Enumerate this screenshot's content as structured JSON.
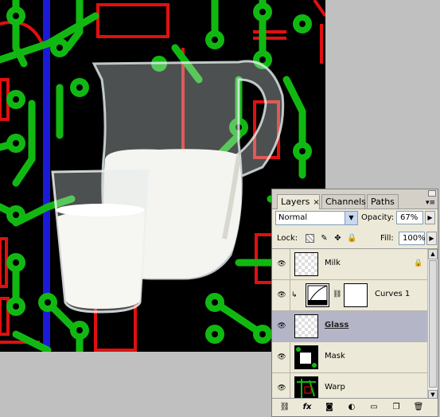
{
  "panel": {
    "tabs": [
      {
        "label": "Layers",
        "close": "×",
        "active": true
      },
      {
        "label": "Channels",
        "active": false
      },
      {
        "label": "Paths",
        "active": false
      }
    ],
    "blend_mode": "Normal",
    "opacity_label": "Opacity:",
    "opacity_value": "67%",
    "lock_label": "Lock:",
    "fill_label": "Fill:",
    "fill_value": "100%",
    "layers": [
      {
        "name": "Milk",
        "visible": true,
        "locked": true,
        "selected": false,
        "thumb": "milk-thumbnail"
      },
      {
        "name": "Curves 1",
        "visible": true,
        "adjustment": true,
        "selected": false,
        "thumb": "curves-adjustment-icon"
      },
      {
        "name": "Glass",
        "visible": true,
        "selected": true,
        "thumb": "glass-thumbnail"
      },
      {
        "name": "Mask",
        "visible": true,
        "selected": false,
        "thumb": "mask-thumbnail"
      },
      {
        "name": "Warp",
        "visible": true,
        "selected": false,
        "thumb": "warp-thumbnail"
      }
    ],
    "bottom_icons": [
      "link-layers-icon",
      "fx-icon",
      "add-mask-icon",
      "adjustment-layer-icon",
      "new-group-icon",
      "new-layer-icon",
      "trash-icon"
    ]
  },
  "document": {
    "content": "milk-pitcher-and-glass-on-circuit-board",
    "colors": {
      "background": "#000000",
      "trace_green": "#10c010",
      "trace_red": "#e01010",
      "trace_blue": "#1010e0",
      "canvas_gray": "#c0c0c0"
    }
  }
}
